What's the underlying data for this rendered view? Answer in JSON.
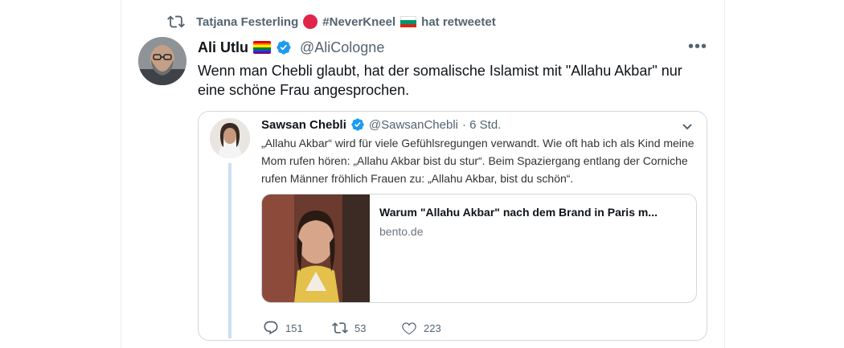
{
  "retweet": {
    "user": "Tatjana Festerling",
    "tag": "#NeverKneel",
    "suffix": "hat retweetet"
  },
  "tweet": {
    "name": "Ali Utlu",
    "handle": "@AliCologne",
    "text": "Wenn man Chebli glaubt, hat der somalische Islamist mit \"Allahu Akbar\" nur eine schöne Frau angesprochen."
  },
  "quote": {
    "name": "Sawsan Chebli",
    "handle": "@SawsanChebli",
    "time": "· 6 Std.",
    "text": "„Allahu Akbar“ wird für viele Gefühlsregungen verwandt. Wie oft hab ich als Kind meine Mom rufen hören: „Allahu Akbar bist du stur“. Beim Spaziergang entlang der Corniche rufen Männer fröhlich Frauen zu: „Allahu Akbar, bist du schön“.",
    "card": {
      "title": "Warum \"Allahu Akbar\" nach dem Brand in Paris m...",
      "domain": "bento.de"
    },
    "stats": {
      "replies": "151",
      "retweets": "53",
      "likes": "223"
    }
  },
  "colors": {
    "verified": "#1d9bf0",
    "neverkneel_dot": "#e0254a",
    "text_secondary": "#536471"
  }
}
